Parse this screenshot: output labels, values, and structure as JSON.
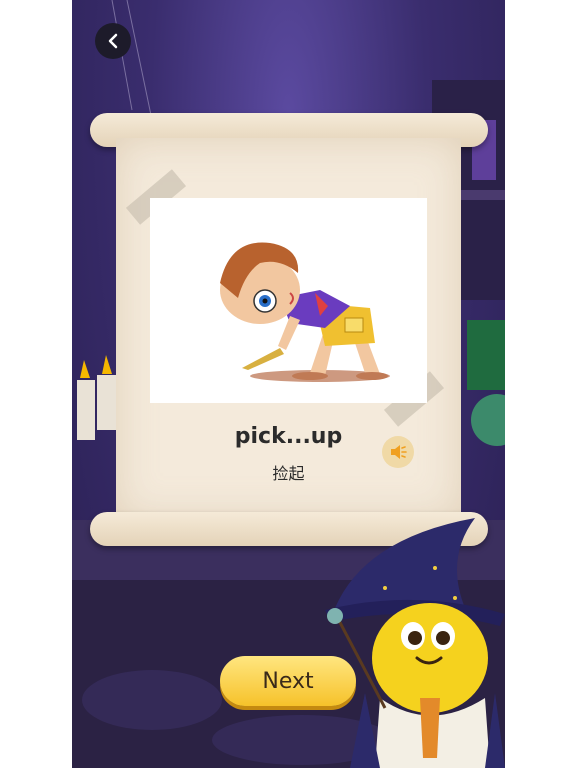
{
  "card": {
    "word": "pick...up",
    "meaning": "捡起"
  },
  "buttons": {
    "next_label": "Next"
  },
  "icons": {
    "back": "chevron-left-icon",
    "speaker": "speaker-icon"
  },
  "colors": {
    "next_button": "#f6c22a",
    "scene_bg": "#3a2d6e",
    "paper": "#f4eadb"
  }
}
